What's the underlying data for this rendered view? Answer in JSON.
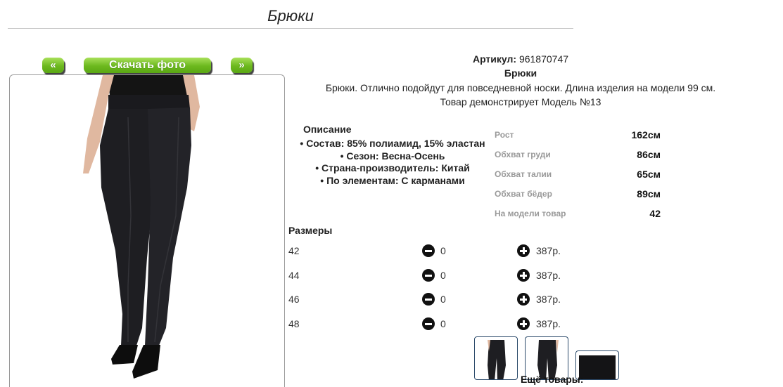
{
  "header": {
    "title": "Брюки"
  },
  "gallery": {
    "prev_label": "«",
    "download_label": "Скачать фото",
    "next_label": "»"
  },
  "product": {
    "article_label": "Артикул:",
    "article_value": "961870747",
    "name": "Брюки",
    "description": "Брюки. Отлично подойдут для повседневной носки. Длина изделия на модели 99 см.",
    "model_note": "Товар демонстрирует Модель №13"
  },
  "description_block": {
    "title": "Описание",
    "items": [
      "Состав: 85% полиамид, 15% эластан",
      "Сезон: Весна-Осень",
      "Страна-производитель: Китай",
      "По элементам: С карманами"
    ]
  },
  "model_params": [
    {
      "label": "Рост",
      "value": "162см"
    },
    {
      "label": "Обхват груди",
      "value": "86см"
    },
    {
      "label": "Обхват талии",
      "value": "65см"
    },
    {
      "label": "Обхват бёдер",
      "value": "89см"
    },
    {
      "label": "На модели товар",
      "value": "42"
    }
  ],
  "sizes": {
    "title": "Размеры",
    "rows": [
      {
        "size": "42",
        "qty": "0",
        "price": "387р."
      },
      {
        "size": "44",
        "qty": "0",
        "price": "387р."
      },
      {
        "size": "46",
        "qty": "0",
        "price": "387р."
      },
      {
        "size": "48",
        "qty": "0",
        "price": "387р."
      }
    ]
  },
  "more_label": "Ещё товары:",
  "colors": {
    "button_green": "#6cb81e",
    "pants": "#1e1e22",
    "thumb_border": "#2b4a6a"
  }
}
